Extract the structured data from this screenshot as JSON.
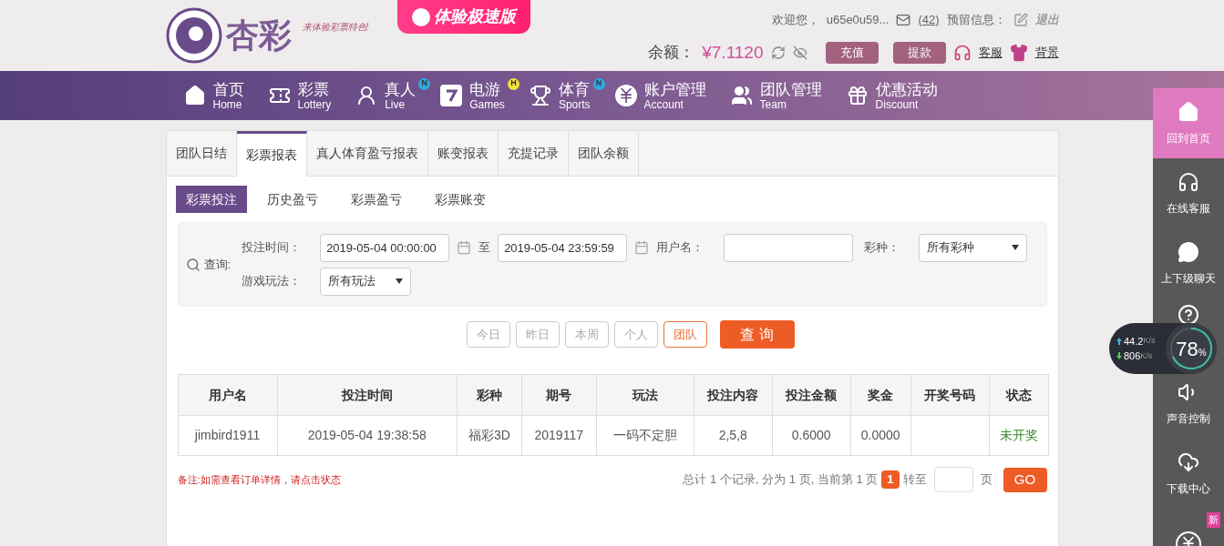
{
  "header": {
    "logo_text": "杏彩",
    "slogan": "来体验彩票特色!",
    "promo_button": "体验极速版",
    "welcome": "欢迎您，",
    "username": "u65e0u59...",
    "messages": "(42)",
    "reserved_label": "预留信息：",
    "logout": "退出",
    "balance_label": "余额：",
    "balance": "¥7.1120",
    "deposit": "充值",
    "withdraw": "提款",
    "service": "客服",
    "background": "背景"
  },
  "nav": [
    {
      "kind": "home",
      "label": "首页",
      "sub": "Home"
    },
    {
      "kind": "ticket",
      "label": "彩票",
      "sub": "Lottery"
    },
    {
      "kind": "live",
      "label": "真人",
      "sub": "Live",
      "badge": "N",
      "color": "#2fa8e0"
    },
    {
      "kind": "games",
      "label": "电游",
      "sub": "Games",
      "badge": "H",
      "color": "#f2e23a"
    },
    {
      "kind": "trophy",
      "label": "体育",
      "sub": "Sports",
      "badge": "N",
      "color": "#2fa8e0"
    },
    {
      "kind": "account",
      "label": "账户管理",
      "sub": "Account"
    },
    {
      "kind": "team",
      "label": "团队管理",
      "sub": "Team"
    },
    {
      "kind": "gift",
      "label": "优惠活动",
      "sub": "Discount"
    }
  ],
  "tabs": [
    {
      "label": "团队日结",
      "selected": false
    },
    {
      "label": "彩票报表",
      "selected": true
    },
    {
      "label": "真人体育盈亏报表",
      "selected": false
    },
    {
      "label": "账变报表",
      "selected": false
    },
    {
      "label": "充提记录",
      "selected": false
    },
    {
      "label": "团队余额",
      "selected": false
    }
  ],
  "subtabs": [
    {
      "label": "彩票投注",
      "selected": true
    },
    {
      "label": "历史盈亏",
      "selected": false
    },
    {
      "label": "彩票盈亏",
      "selected": false
    },
    {
      "label": "彩票账变",
      "selected": false
    }
  ],
  "query": {
    "label": "查询:",
    "time_label": "投注时间：",
    "start": "2019-05-04 00:00:00",
    "to": "至",
    "end": "2019-05-04 23:59:59",
    "user_label": "用户名：",
    "lottery_label": "彩种：",
    "lottery": "所有彩种",
    "play_label": "游戏玩法：",
    "play": "所有玩法"
  },
  "quick_filters": [
    {
      "label": "今日",
      "selected": false
    },
    {
      "label": "昨日",
      "selected": false
    },
    {
      "label": "本周",
      "selected": false
    },
    {
      "label": "个人",
      "selected": false
    },
    {
      "label": "团队",
      "selected": true
    }
  ],
  "search_button": "查 询",
  "table": {
    "columns": [
      "用户名",
      "投注时间",
      "彩种",
      "期号",
      "玩法",
      "投注内容",
      "投注金额",
      "奖金",
      "开奖号码",
      "状态"
    ],
    "rows": [
      [
        "jimbird1911",
        "2019-05-04 19:38:58",
        "福彩3D",
        "2019117",
        "一码不定胆",
        "2,5,8",
        "0.6000",
        "0.0000",
        "",
        "未开奖"
      ]
    ]
  },
  "note": "备注:如需查看订单详情，请点击状态",
  "pagination": {
    "summary": "总计 1 个记录, 分为 1 页, 当前第 1 页",
    "current": "1",
    "goto": "转至",
    "page": "页",
    "go": "GO"
  },
  "sidebar": [
    {
      "kind": "home",
      "label": "回到首页",
      "selected": true
    },
    {
      "kind": "service",
      "label": "在线客服",
      "selected": false
    },
    {
      "kind": "chat",
      "label": "上下级聊天",
      "selected": false
    },
    {
      "kind": "hidden",
      "selected": false
    },
    {
      "kind": "sound",
      "label": "声音控制",
      "selected": false
    },
    {
      "kind": "download",
      "label": "下载中心",
      "selected": false
    },
    {
      "kind": "money",
      "badge": "新",
      "selected": false
    }
  ],
  "net_widget": {
    "up": "44.2",
    "up_unit": "K/s",
    "down": "806",
    "down_unit": "K/s",
    "percent": "78",
    "percent_sign": "%"
  }
}
